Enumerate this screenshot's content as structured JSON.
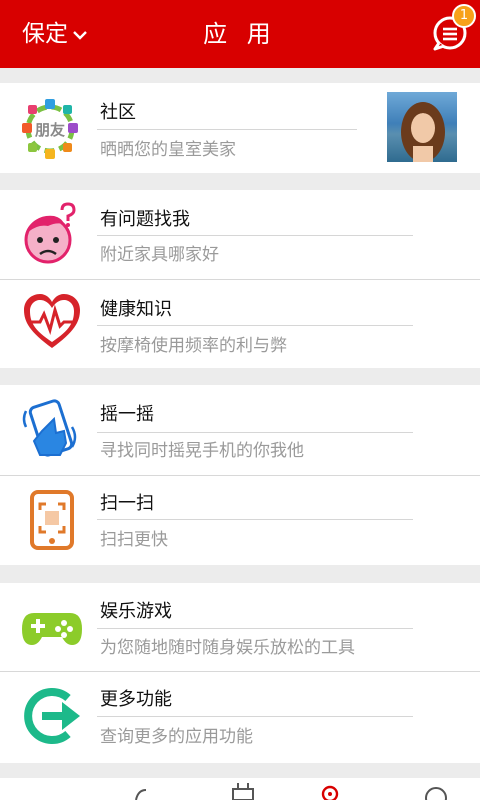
{
  "header": {
    "city_label": "保定",
    "title": "应 用",
    "message_badge": "1"
  },
  "items": [
    {
      "name": "社区",
      "desc": "晒晒您的皇室美家",
      "icon": "friends-icon",
      "icon_text": "朋友"
    },
    {
      "name": "有问题找我",
      "desc": "附近家具哪家好",
      "icon": "question-face-icon"
    },
    {
      "name": "健康知识",
      "desc": "按摩椅使用频率的利与弊",
      "icon": "heart-pulse-icon"
    },
    {
      "name": "摇一摇",
      "desc": "寻找同时摇晃手机的你我他",
      "icon": "shake-phone-icon"
    },
    {
      "name": "扫一扫",
      "desc": "扫扫更快",
      "icon": "scan-phone-icon"
    },
    {
      "name": "娱乐游戏",
      "desc": "为您随地随时随身娱乐放松的工具",
      "icon": "gamepad-icon"
    },
    {
      "name": "更多功能",
      "desc": "查询更多的应用功能",
      "icon": "more-arrow-icon"
    }
  ],
  "colors": {
    "brand_red": "#d80000",
    "badge_orange": "#f7a11a",
    "game_green": "#8ccc2a",
    "more_teal": "#1db98a"
  }
}
